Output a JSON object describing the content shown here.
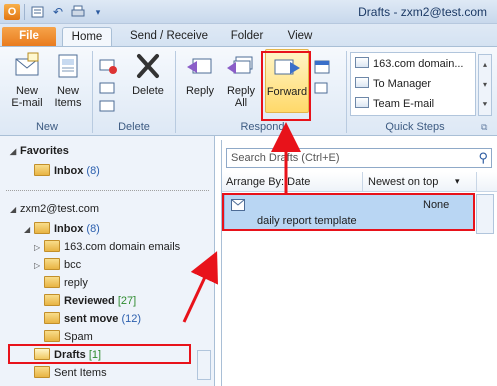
{
  "window": {
    "title": "Drafts - zxm2@test.com"
  },
  "tabs": [
    {
      "label": "File"
    },
    {
      "label": "Home"
    },
    {
      "label": "Send / Receive"
    },
    {
      "label": "Folder"
    },
    {
      "label": "View"
    }
  ],
  "ribbon": {
    "new": {
      "new_email": "New\nE-mail",
      "new_items": "New\nItems",
      "group": "New"
    },
    "delete": {
      "delete_label": "Delete",
      "group": "Delete"
    },
    "respond": {
      "reply": "Reply",
      "reply_all": "Reply\nAll",
      "forward": "Forward",
      "group": "Respond"
    },
    "quick_steps": {
      "items": [
        "163.com domain...",
        "To Manager",
        "Team E-mail"
      ],
      "group": "Quick Steps"
    }
  },
  "nav": {
    "favorites_header": "Favorites",
    "favorites": [
      {
        "name": "Inbox",
        "count": "(8)"
      }
    ],
    "account": "zxm2@test.com",
    "folders": [
      {
        "name": "Inbox",
        "count": "(8)"
      },
      {
        "name": "163.com domain emails",
        "count": ""
      },
      {
        "name": "bcc",
        "count": ""
      },
      {
        "name": "reply",
        "count": ""
      },
      {
        "name": "Reviewed",
        "count": "[27]"
      },
      {
        "name": "sent move",
        "count": "(12)"
      },
      {
        "name": "Spam",
        "count": ""
      },
      {
        "name": "Drafts",
        "count": "[1]"
      },
      {
        "name": "Sent Items",
        "count": ""
      }
    ]
  },
  "list": {
    "search_placeholder": "Search Drafts (Ctrl+E)",
    "arrange_by": "Arrange By: Date",
    "sort_order": "Newest on top",
    "message": {
      "recipient": "None",
      "subject": "daily report template"
    }
  },
  "colors": {
    "annotation": "#e8121a",
    "file_tab": "#e8791c",
    "selection": "#b9d6f3"
  }
}
